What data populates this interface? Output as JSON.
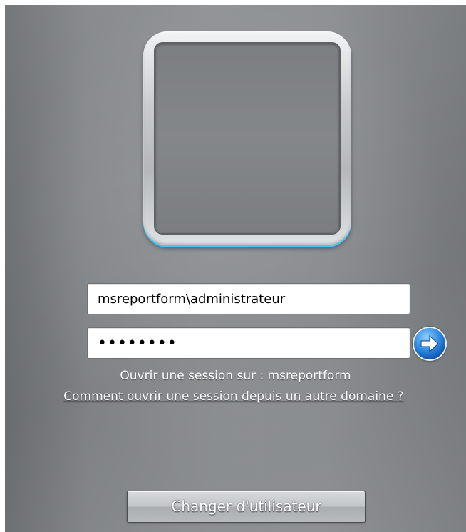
{
  "login": {
    "username_value": "msreportform\\administrateur",
    "password_value": "••••••••",
    "logon_to_text": "Ouvrir une session sur : msreportform",
    "other_domain_link": "Comment ouvrir une session depuis un autre domaine ?",
    "switch_user_label": "Changer d'utilisateur",
    "submit_icon": "arrow-right-icon"
  },
  "colors": {
    "tile_glow": "#4fc4e8",
    "submit_blue": "#2f8ae0",
    "background_gray": "#8c8f92"
  }
}
